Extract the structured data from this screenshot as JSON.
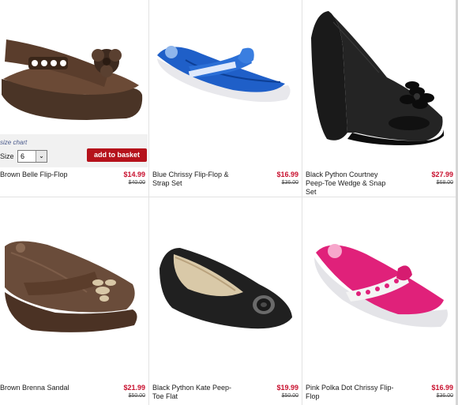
{
  "products": [
    {
      "name": "Brown Belle Flip-Flop",
      "price": "$14.99",
      "old_price": "$40.00",
      "image_icon": "brown-wedge-flipflop-icon"
    },
    {
      "name": "Blue Chrissy Flip-Flop & Strap Set",
      "price": "$16.99",
      "old_price": "$36.00",
      "image_icon": "blue-flipflop-icon"
    },
    {
      "name": "Black Python Courtney Peep-Toe Wedge & Snap Set",
      "price": "$27.99",
      "old_price": "$68.00",
      "image_icon": "black-peeptoe-wedge-icon"
    },
    {
      "name": "Brown Brenna Sandal",
      "price": "$21.99",
      "old_price": "$50.00",
      "image_icon": "brown-wedge-sandal-icon"
    },
    {
      "name": "Black Python Kate Peep-Toe Flat",
      "price": "$19.99",
      "old_price": "$50.00",
      "image_icon": "black-peeptoe-flat-icon"
    },
    {
      "name": "Pink Polka Dot Chrissy Flip-Flop",
      "price": "$16.99",
      "old_price": "$36.00",
      "image_icon": "pink-flipflop-icon"
    }
  ],
  "hover_panel": {
    "size_chart_link": "size chart",
    "size_label": "Size",
    "size_value": "6",
    "add_to_basket": "add to basket"
  },
  "colors": {
    "price_red": "#c8102e",
    "basket_button": "#b5121b"
  }
}
